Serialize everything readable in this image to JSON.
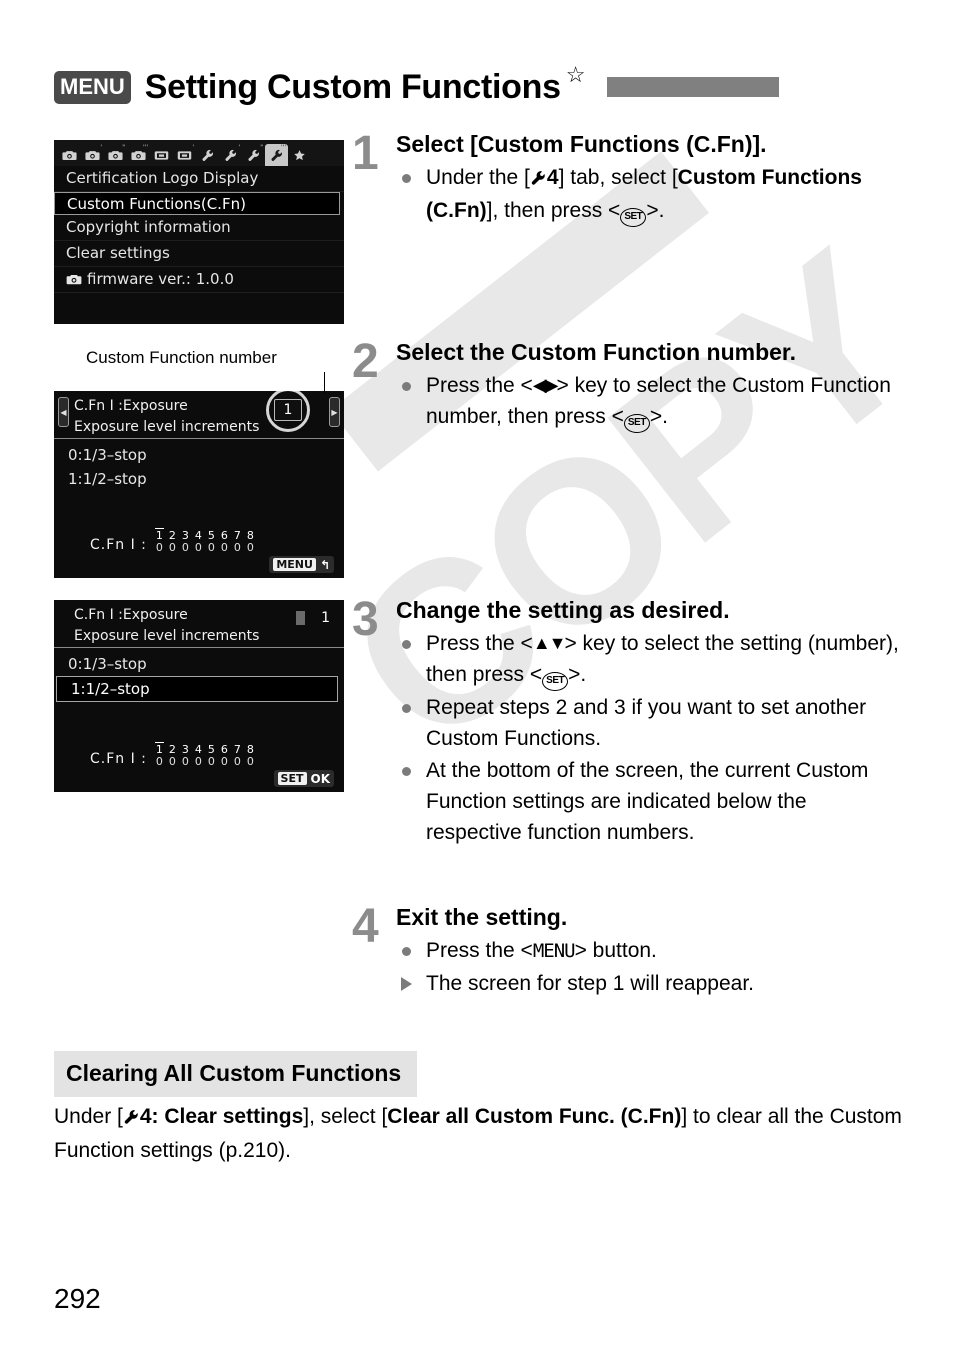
{
  "page": {
    "number": "292",
    "title": "Setting Custom Functions",
    "menu_badge": "MENU",
    "star_icon": "☆"
  },
  "screen1": {
    "name": "setup-menu-tab-4",
    "tabs": [
      {
        "icon": "camera-icon",
        "sup": ""
      },
      {
        "icon": "camera-icon",
        "sup": "'"
      },
      {
        "icon": "camera-icon",
        "sup": "\""
      },
      {
        "icon": "camera-icon",
        "sup": "'''"
      },
      {
        "icon": "playback-icon",
        "sup": ""
      },
      {
        "icon": "playback-icon",
        "sup": "'"
      },
      {
        "icon": "wrench-icon",
        "sup": ""
      },
      {
        "icon": "wrench-icon",
        "sup": "'"
      },
      {
        "icon": "wrench-icon",
        "sup": "\""
      },
      {
        "icon": "wrench-icon",
        "sup": "'''"
      },
      {
        "icon": "star-icon",
        "sup": ""
      }
    ],
    "active_tab_index": 9,
    "rows": [
      {
        "label": "Certification Logo Display",
        "selected": false,
        "icon": ""
      },
      {
        "label": "Custom Functions(C.Fn)",
        "selected": true,
        "icon": ""
      },
      {
        "label": "Copyright information",
        "selected": false,
        "icon": ""
      },
      {
        "label": "Clear settings",
        "selected": false,
        "icon": ""
      },
      {
        "label": "firmware ver.: 1.0.0",
        "selected": false,
        "icon": "camera-icon"
      }
    ]
  },
  "caption": {
    "custom_function_number": "Custom Function number"
  },
  "screen2": {
    "title_line1": "C.Fn I :Exposure",
    "title_line2": "Exposure level increments",
    "number": "1",
    "options": [
      {
        "label": "0:1/3–stop",
        "selected": false
      },
      {
        "label": "1:1/2–stop",
        "selected": false
      }
    ],
    "footer_label": "C.Fn I :",
    "footer_indices": [
      "1",
      "2",
      "3",
      "4",
      "5",
      "6",
      "7",
      "8"
    ],
    "footer_values": [
      "0",
      "0",
      "0",
      "0",
      "0",
      "0",
      "0",
      "0"
    ],
    "current_index": 0,
    "button_key": "MENU",
    "button_action": "↰"
  },
  "screen3": {
    "title_line1": "C.Fn I :Exposure",
    "title_line2": "Exposure level increments",
    "number": "1",
    "options": [
      {
        "label": "0:1/3–stop",
        "selected": false
      },
      {
        "label": "1:1/2–stop",
        "selected": true
      }
    ],
    "footer_label": "C.Fn I :",
    "footer_indices": [
      "1",
      "2",
      "3",
      "4",
      "5",
      "6",
      "7",
      "8"
    ],
    "footer_values": [
      "0",
      "0",
      "0",
      "0",
      "0",
      "0",
      "0",
      "0"
    ],
    "current_index": 0,
    "button_key": "SET",
    "button_action": "OK"
  },
  "steps": [
    {
      "num": "1",
      "heading": "Select [Custom Functions (C.Fn)].",
      "bullets": [
        {
          "marker": "dot",
          "segments": [
            {
              "t": "Under the [",
              "style": "normal"
            },
            {
              "t": "wrench-icon",
              "style": "icon-wrench"
            },
            {
              "t": "4",
              "style": "bold"
            },
            {
              "t": "] tab, select [",
              "style": "normal"
            },
            {
              "t": "Custom Functions (C.Fn)",
              "style": "bold"
            },
            {
              "t": "], then press <",
              "style": "normal"
            },
            {
              "t": "SET",
              "style": "icon-set"
            },
            {
              "t": ">.",
              "style": "normal"
            }
          ]
        }
      ]
    },
    {
      "num": "2",
      "heading": "Select the Custom Function number.",
      "bullets": [
        {
          "marker": "dot",
          "segments": [
            {
              "t": "Press the <",
              "style": "normal"
            },
            {
              "t": "◀▶",
              "style": "arrow-lr"
            },
            {
              "t": "> key to select the Custom Function number, then press <",
              "style": "normal"
            },
            {
              "t": "SET",
              "style": "icon-set"
            },
            {
              "t": ">.",
              "style": "normal"
            }
          ]
        }
      ]
    },
    {
      "num": "3",
      "heading": "Change the setting as desired.",
      "bullets": [
        {
          "marker": "dot",
          "segments": [
            {
              "t": "Press the <",
              "style": "normal"
            },
            {
              "t": "▲▼",
              "style": "arrow-ud"
            },
            {
              "t": "> key to select the setting (number), then press <",
              "style": "normal"
            },
            {
              "t": "SET",
              "style": "icon-set"
            },
            {
              "t": ">.",
              "style": "normal"
            }
          ]
        },
        {
          "marker": "dot",
          "segments": [
            {
              "t": "Repeat steps 2 and 3 if you want to set another Custom Functions.",
              "style": "normal"
            }
          ]
        },
        {
          "marker": "dot",
          "segments": [
            {
              "t": "At the bottom of the screen, the current Custom Function settings are indicated below the respective function numbers.",
              "style": "normal"
            }
          ]
        }
      ]
    },
    {
      "num": "4",
      "heading": "Exit the setting.",
      "bullets": [
        {
          "marker": "dot",
          "segments": [
            {
              "t": "Press the <",
              "style": "normal"
            },
            {
              "t": "MENU",
              "style": "menu-inline"
            },
            {
              "t": "> button.",
              "style": "normal"
            }
          ]
        },
        {
          "marker": "tri",
          "segments": [
            {
              "t": "The screen for step 1 will reappear.",
              "style": "normal"
            }
          ]
        }
      ]
    }
  ],
  "section": {
    "heading": "Clearing All Custom Functions",
    "body_segments": [
      {
        "t": "Under [",
        "style": "normal"
      },
      {
        "t": "wrench-icon",
        "style": "icon-wrench-bold"
      },
      {
        "t": "4: Clear settings",
        "style": "bold"
      },
      {
        "t": "], select [",
        "style": "normal"
      },
      {
        "t": "Clear all Custom Func. (C.Fn)",
        "style": "bold"
      },
      {
        "t": "] to clear all the Custom Function settings (p.210).",
        "style": "normal"
      }
    ]
  },
  "watermark": {
    "text": "COPY"
  },
  "colors": {
    "title_bar": "#808080",
    "step_number": "#8c8c8c",
    "bullet_dot": "#7b7b7b",
    "section_bg": "#e3e3e3",
    "screen_bg": "#0c0c0c",
    "watermark": "#e8e8e8"
  }
}
